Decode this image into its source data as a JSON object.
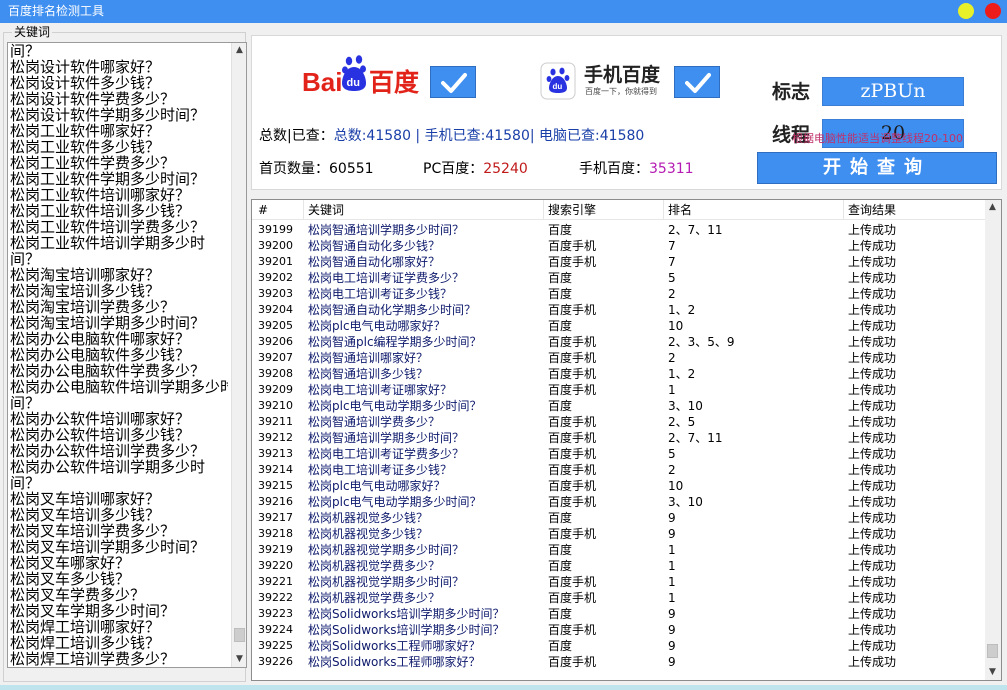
{
  "window": {
    "title": "百度排名检测工具"
  },
  "keywords": {
    "legend": "关键词",
    "lines": [
      "间？",
      "松岗设计软件哪家好？",
      "松岗设计软件多少钱？",
      "松岗设计软件学费多少？",
      "松岗设计软件学期多少时间？",
      "松岗工业软件哪家好？",
      "松岗工业软件多少钱？",
      "松岗工业软件学费多少？",
      "松岗工业软件学期多少时间？",
      "松岗工业软件培训哪家好？",
      "松岗工业软件培训多少钱？",
      "松岗工业软件培训学费多少？",
      "松岗工业软件培训学期多少时",
      "间？",
      "松岗淘宝培训哪家好？",
      "松岗淘宝培训多少钱？",
      "松岗淘宝培训学费多少？",
      "松岗淘宝培训学期多少时间？",
      "松岗办公电脑软件哪家好？",
      "松岗办公电脑软件多少钱？",
      "松岗办公电脑软件学费多少？",
      "松岗办公电脑软件培训学期多少时",
      "间？",
      "松岗办公软件培训哪家好？",
      "松岗办公软件培训多少钱？",
      "松岗办公软件培训学费多少？",
      "松岗办公软件培训学期多少时",
      "间？",
      "松岗叉车培训哪家好？",
      "松岗叉车培训多少钱？",
      "松岗叉车培训学费多少？",
      "松岗叉车培训学期多少时间？",
      "松岗叉车哪家好？",
      "松岗叉车多少钱？",
      "松岗叉车学费多少？",
      "松岗叉车学期多少时间？",
      "松岗焊工培训哪家好？",
      "松岗焊工培训多少钱？",
      "松岗焊工培训学费多少？"
    ],
    "scroll_position": 0.98
  },
  "logos": {
    "baidu_text": "Bai百度",
    "baidu_du": "du",
    "mobile_title": "手机百度",
    "mobile_sub": "百度一下，你就得到"
  },
  "stats": {
    "total_label": "总数|已查：",
    "total_text": "总数:41580",
    "sep1": " | ",
    "mobile_checked": "手机已查:41580",
    "sep2": "| ",
    "pc_checked": "电脑已查:41580",
    "home_label": "首页数量：",
    "home_value": "60551",
    "pc_label": "PC百度：",
    "pc_value": "25240",
    "mobile_label": "手机百度：",
    "mobile_value": "35311"
  },
  "controls": {
    "tag_label": "标志",
    "tag_value": "zPBUn",
    "thread_label": "线程",
    "thread_value": "20",
    "hint": "根据电脑性能适当调整线程20-100",
    "start_label": "开始查询"
  },
  "table": {
    "headers": [
      "#",
      "关键词",
      "搜索引擎",
      "排名",
      "查询结果"
    ],
    "scroll_position": 0.98,
    "rows": [
      [
        "39199",
        "松岗智通培训学期多少时间？",
        "百度",
        "2、7、11",
        "上传成功"
      ],
      [
        "39200",
        "松岗智通自动化多少钱？",
        "百度手机",
        "7",
        "上传成功"
      ],
      [
        "39201",
        "松岗智通自动化哪家好？",
        "百度手机",
        "7",
        "上传成功"
      ],
      [
        "39202",
        "松岗电工培训考证学费多少？",
        "百度",
        "5",
        "上传成功"
      ],
      [
        "39203",
        "松岗电工培训考证多少钱？",
        "百度",
        "2",
        "上传成功"
      ],
      [
        "39204",
        "松岗智通自动化学期多少时间？",
        "百度手机",
        "1、2",
        "上传成功"
      ],
      [
        "39205",
        "松岗plc电气电动哪家好？",
        "百度",
        "10",
        "上传成功"
      ],
      [
        "39206",
        "松岗智通plc编程学期多少时间？",
        "百度手机",
        "2、3、5、9",
        "上传成功"
      ],
      [
        "39207",
        "松岗智通培训哪家好？",
        "百度手机",
        "2",
        "上传成功"
      ],
      [
        "39208",
        "松岗智通培训多少钱？",
        "百度手机",
        "1、2",
        "上传成功"
      ],
      [
        "39209",
        "松岗电工培训考证哪家好？",
        "百度手机",
        "1",
        "上传成功"
      ],
      [
        "39210",
        "松岗plc电气电动学期多少时间？",
        "百度",
        "3、10",
        "上传成功"
      ],
      [
        "39211",
        "松岗智通培训学费多少？",
        "百度手机",
        "2、5",
        "上传成功"
      ],
      [
        "39212",
        "松岗智通培训学期多少时间？",
        "百度手机",
        "2、7、11",
        "上传成功"
      ],
      [
        "39213",
        "松岗电工培训考证学费多少？",
        "百度手机",
        "5",
        "上传成功"
      ],
      [
        "39214",
        "松岗电工培训考证多少钱？",
        "百度手机",
        "2",
        "上传成功"
      ],
      [
        "39215",
        "松岗plc电气电动哪家好？",
        "百度手机",
        "10",
        "上传成功"
      ],
      [
        "39216",
        "松岗plc电气电动学期多少时间？",
        "百度手机",
        "3、10",
        "上传成功"
      ],
      [
        "39217",
        "松岗机器视觉多少钱？",
        "百度",
        "9",
        "上传成功"
      ],
      [
        "39218",
        "松岗机器视觉多少钱？",
        "百度手机",
        "9",
        "上传成功"
      ],
      [
        "39219",
        "松岗机器视觉学期多少时间？",
        "百度",
        "1",
        "上传成功"
      ],
      [
        "39220",
        "松岗机器视觉学费多少？",
        "百度",
        "1",
        "上传成功"
      ],
      [
        "39221",
        "松岗机器视觉学期多少时间？",
        "百度手机",
        "1",
        "上传成功"
      ],
      [
        "39222",
        "松岗机器视觉学费多少？",
        "百度手机",
        "1",
        "上传成功"
      ],
      [
        "39223",
        "松岗Solidworks培训学期多少时间？",
        "百度",
        "9",
        "上传成功"
      ],
      [
        "39224",
        "松岗Solidworks培训学期多少时间？",
        "百度手机",
        "9",
        "上传成功"
      ],
      [
        "39225",
        "松岗Solidworks工程师哪家好？",
        "百度",
        "9",
        "上传成功"
      ],
      [
        "39226",
        "松岗Solidworks工程师哪家好？",
        "百度手机",
        "9",
        "上传成功"
      ]
    ]
  },
  "colors": {
    "accent": "#3f8ff0",
    "baidu_red": "#e2231a",
    "baidu_blue": "#2932e1",
    "pc_value": "#c11a1a",
    "mobile_value": "#b41ab4",
    "hint": "#c0306a"
  }
}
